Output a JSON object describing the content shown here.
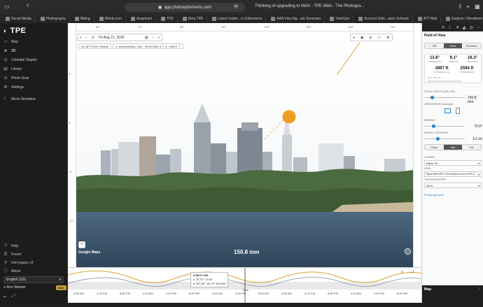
{
  "browser": {
    "url": "app.photoephemeris.com",
    "tabs": [
      {
        "label": "Social Media"
      },
      {
        "label": "Photography"
      },
      {
        "label": "Biking"
      },
      {
        "label": "Windy.com"
      },
      {
        "label": "Angelcam"
      },
      {
        "label": "TPE"
      },
      {
        "label": "Beta TPE"
      },
      {
        "label": "Latest Inside...r's Ephemeris"
      },
      {
        "label": "AAA Visa Sig...unt Summary"
      },
      {
        "label": "GeleGps"
      },
      {
        "label": "Account Setti...aries Schwab"
      },
      {
        "label": "ATT Mail"
      },
      {
        "label": "Explore | Wondrium"
      }
    ],
    "active_tab_title": "Thinking of upgrading to MAX - TPE Web - The Photogra..."
  },
  "sidebar": {
    "logo": "TPE",
    "items": [
      {
        "label": "Map",
        "icon": "map-icon"
      },
      {
        "label": "3D",
        "icon": "cube-icon"
      },
      {
        "label": "Celestial Targets",
        "icon": "target-icon"
      },
      {
        "label": "Library",
        "icon": "library-icon"
      },
      {
        "label": "Photo Gear",
        "icon": "camera-icon"
      },
      {
        "label": "Settings",
        "icon": "gear-icon"
      },
      {
        "label": "Moon Simulator",
        "icon": "moon-icon"
      }
    ],
    "bottom_items": [
      {
        "label": "Help",
        "icon": "help-icon"
      },
      {
        "label": "Forum",
        "icon": "forum-icon"
      },
      {
        "label": "Use legacy v3",
        "icon": "legacy-icon"
      },
      {
        "label": "About",
        "icon": "info-icon"
      }
    ],
    "language": "English (US)",
    "user": "Ron Skinner",
    "badge": "MAX"
  },
  "view": {
    "date": "Fri Aug 21, 2026",
    "coords": "41.487776,81.795456",
    "timezone": "America/New_York · 04:00 GMT-4",
    "elevation": "+638 ft",
    "focal_overlay": "150.8 mm",
    "google_logo": "Google Maps",
    "ruler_marks": [
      "50°",
      "70°",
      "80°",
      "90°",
      "100°",
      "110°",
      "120°",
      "130°"
    ],
    "left_ruler": [
      "5°",
      "0°",
      "-5°",
      "-10°"
    ]
  },
  "timeline": {
    "time": "6:58:07 AM",
    "sun_row": [
      "75.73°",
      "+2.33°"
    ],
    "moon_row": [
      "207.00°",
      "-69.73°",
      "62.90%"
    ],
    "tick_labels": [
      "4:00 AM",
      "2:00 PM",
      "8:00 PM",
      "4:00 AM",
      "2:00 PM",
      "8:00 PM",
      "4:00 AM",
      "2:00 PM",
      "8:00 PM",
      "4:00 AM",
      "2:00 PM",
      "8:00 PM",
      "4:00 AM",
      "2:00 PM",
      "8:00 PM"
    ],
    "now_label": "Tues."
  },
  "right_panel": {
    "title": "Field of View",
    "segments": [
      "Off",
      "Gear",
      "Freeform"
    ],
    "active_segment": "Gear",
    "fov": {
      "horizontal": "13.6°",
      "vertical": "9.1°",
      "diagonal": "16.3°",
      "h_label": "HORIZONTAL",
      "v_label": "VERTICAL",
      "d_label": "DIAGONAL",
      "cov_h": "3897 ft",
      "cov_v": "2594 ft",
      "cov_h_label": "COVERAGE (H)",
      "cov_v_label": "COVERAGE (V)",
      "zoom_note": "Zoom: 151 mm",
      "calc_note": "Calculated using rectilinear projection"
    },
    "focal_label": "FOCAL LENGTH",
    "focal_range": "(100–400)",
    "focal_value": "150.8 mm",
    "orientation_label": "ORIENTATION",
    "orientation_value": "Landscape",
    "bearing_label": "BEARING",
    "bearing_value": "73.9°",
    "distance_label": "SUBJECT DISTANCE",
    "distance_value": "3.1 mi",
    "distance_segments": [
      "Close",
      "Mid",
      "Far"
    ],
    "active_distance": "Mid",
    "camera_label": "CAMERA",
    "camera_value": "Nikon Z9",
    "lens_label": "LENS",
    "lens_value": "Nikon NIKKOR Z 100-400mm f/4.5-5.6 VR S",
    "tele_label": "TELECONVERTER",
    "tele_value": "None",
    "manage_link": "Manage gear",
    "bottom_header": "Map"
  },
  "colors": {
    "sun": "#f0a020",
    "accent": "#1a86d8",
    "badge": "#c9a23a"
  }
}
